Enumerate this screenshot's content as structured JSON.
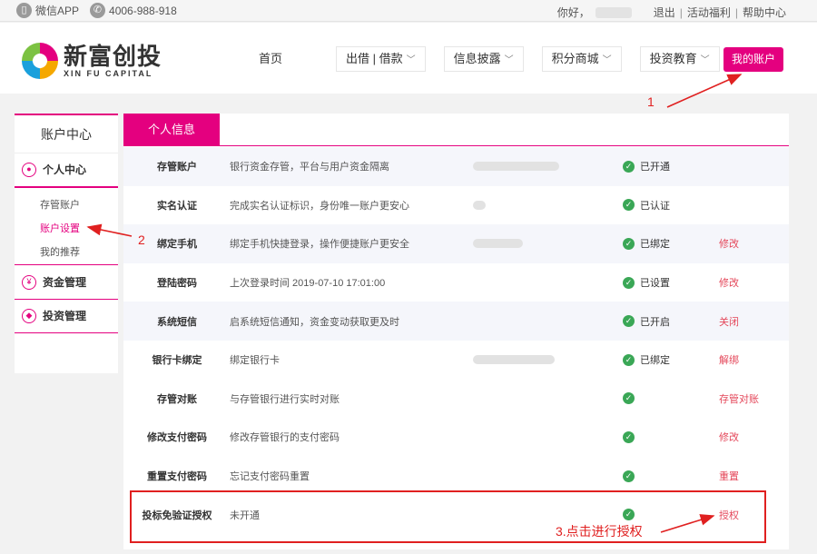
{
  "topbar": {
    "app_label": "微信APP",
    "phone": "4006-988-918",
    "greeting": "你好，",
    "logout": "退出",
    "benefits": "活动福利",
    "help": "帮助中心"
  },
  "logo": {
    "cn": "新富创投",
    "en": "XIN FU CAPITAL"
  },
  "nav": {
    "items": [
      {
        "label": "首页"
      },
      {
        "label": "出借 | 借款"
      },
      {
        "label": "信息披露"
      },
      {
        "label": "积分商城"
      },
      {
        "label": "投资教育"
      }
    ],
    "account_button": "我的账户"
  },
  "sidebar": {
    "title": "账户中心",
    "groups": [
      {
        "label": "个人中心",
        "icon": "person-icon"
      },
      {
        "label": "资金管理",
        "icon": "money-icon"
      },
      {
        "label": "投资管理",
        "icon": "invest-icon"
      }
    ],
    "sub_items": [
      {
        "label": "存管账户"
      },
      {
        "label": "账户设置"
      },
      {
        "label": "我的推荐"
      }
    ]
  },
  "main": {
    "tab": "个人信息",
    "rows": [
      {
        "label": "存管账户",
        "desc": "银行资金存管，平台与用户资金隔离",
        "status": "已开通",
        "action": ""
      },
      {
        "label": "实名认证",
        "desc": "完成实名认证标识，身份唯一账户更安心",
        "status": "已认证",
        "action": ""
      },
      {
        "label": "绑定手机",
        "desc": "绑定手机快捷登录，操作便捷账户更安全",
        "status": "已绑定",
        "action": "修改"
      },
      {
        "label": "登陆密码",
        "desc": "上次登录时间  2019-07-10 17:01:00",
        "status": "已设置",
        "action": "修改"
      },
      {
        "label": "系统短信",
        "desc": "启系统短信通知，资金变动获取更及时",
        "status": "已开启",
        "action": "关闭"
      },
      {
        "label": "银行卡绑定",
        "desc": "绑定银行卡",
        "status": "已绑定",
        "action": "解绑"
      },
      {
        "label": "存管对账",
        "desc": "与存管银行进行实时对账",
        "status": "",
        "action": "存管对账"
      },
      {
        "label": "修改支付密码",
        "desc": "修改存管银行的支付密码",
        "status": "",
        "action": "修改"
      },
      {
        "label": "重置支付密码",
        "desc": "忘记支付密码重置",
        "status": "",
        "action": "重置"
      },
      {
        "label": "投标免验证授权",
        "desc": "未开通",
        "status": "",
        "action": "授权"
      }
    ]
  },
  "annotations": {
    "one": "1",
    "two": "2",
    "three": "3.点击进行授权"
  },
  "colors": {
    "brand": "#e4007f",
    "annotation": "#e02020",
    "check": "#3aa756"
  }
}
